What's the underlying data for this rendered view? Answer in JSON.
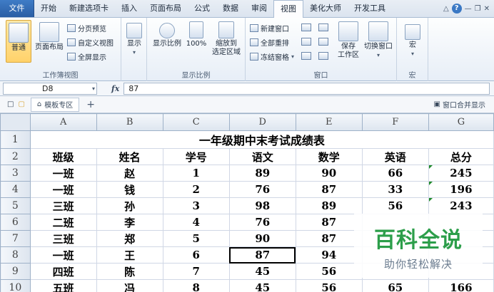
{
  "ribbon_tabs": [
    "文件",
    "开始",
    "新建选项卡",
    "插入",
    "页面布局",
    "公式",
    "数据",
    "审阅",
    "视图",
    "美化大师",
    "开发工具"
  ],
  "active_tab": "视图",
  "groups": {
    "workbook_views": {
      "label": "工作簿视图",
      "normal": "普通",
      "page_layout": "页面布局",
      "page_break": "分页预览",
      "custom_view": "自定义视图",
      "full_screen": "全屏显示"
    },
    "show": {
      "label": "显示"
    },
    "zoom": {
      "label": "显示比例",
      "zoom": "显示比例",
      "hundred": "100%",
      "zoom_sel_1": "缩放到",
      "zoom_sel_2": "选定区域"
    },
    "window": {
      "label": "窗口",
      "new_window": "新建窗口",
      "arrange_all": "全部重排",
      "freeze": "冻结窗格",
      "save_ws_1": "保存",
      "save_ws_2": "工作区",
      "switch": "切换窗口"
    },
    "macros": {
      "label": "宏",
      "macros": "宏"
    }
  },
  "formula_bar": {
    "cell_ref": "D8",
    "fx": "fx",
    "value": "87"
  },
  "doc_bar": {
    "template_tab": "模板专区",
    "merge_label": "窗口合并显示"
  },
  "sheet": {
    "columns": [
      "A",
      "B",
      "C",
      "D",
      "E",
      "F",
      "G"
    ],
    "title": "一年级期中末考试成绩表",
    "headers": [
      "班级",
      "姓名",
      "学号",
      "语文",
      "数学",
      "英语",
      "总分"
    ],
    "rows": [
      [
        "一班",
        "赵",
        "1",
        "89",
        "90",
        "66",
        "245"
      ],
      [
        "一班",
        "钱",
        "2",
        "76",
        "87",
        "33",
        "196"
      ],
      [
        "三班",
        "孙",
        "3",
        "98",
        "89",
        "56",
        "243"
      ],
      [
        "二班",
        "李",
        "4",
        "76",
        "87",
        "",
        ""
      ],
      [
        "三班",
        "郑",
        "5",
        "90",
        "87",
        "",
        ""
      ],
      [
        "一班",
        "王",
        "6",
        "87",
        "94",
        "",
        ""
      ],
      [
        "四班",
        "陈",
        "7",
        "45",
        "56",
        "",
        ""
      ],
      [
        "五班",
        "冯",
        "8",
        "45",
        "56",
        "65",
        "166"
      ]
    ]
  },
  "watermark": {
    "title": "百科全说",
    "subtitle": "助你轻松解决"
  }
}
